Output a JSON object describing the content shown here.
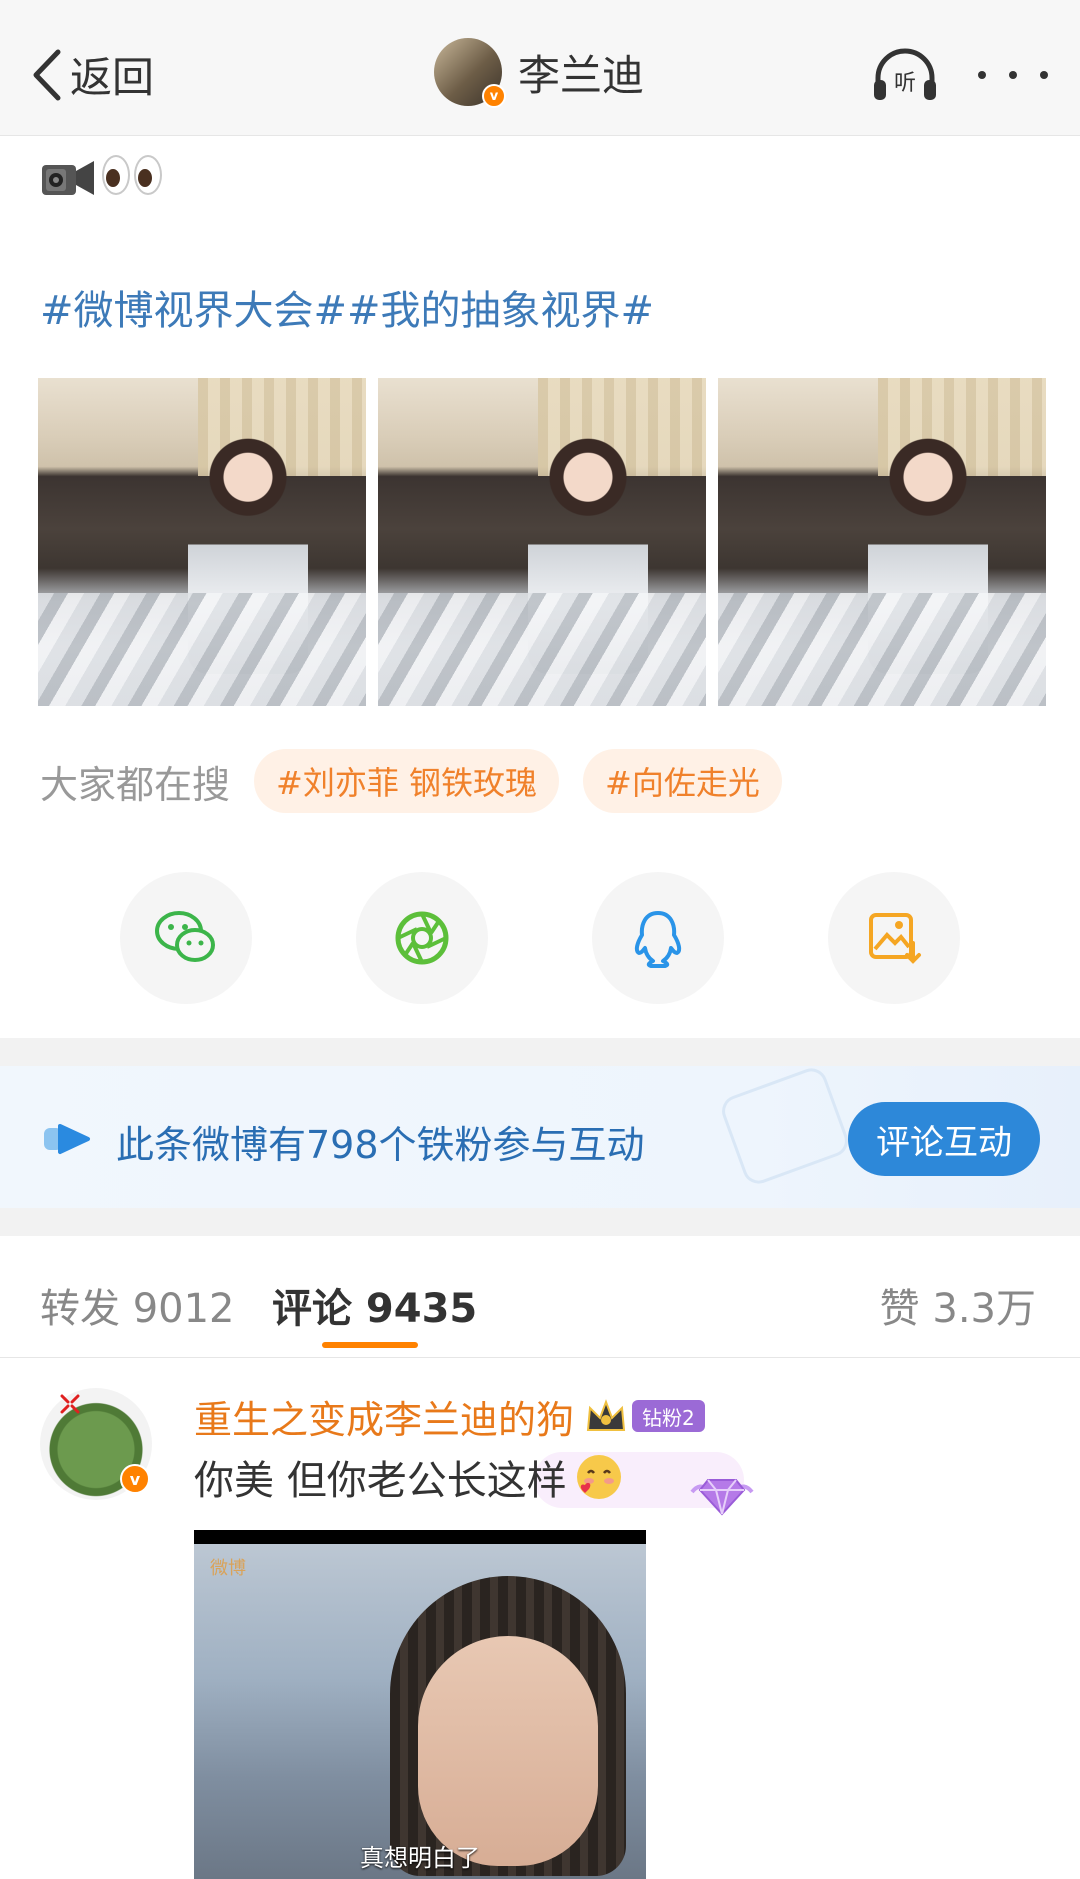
{
  "nav": {
    "back_label": "返回",
    "title": "李兰迪",
    "verified_mark": "v",
    "listen_label": "听"
  },
  "post": {
    "emojis": [
      "video-camera-icon",
      "eyes-icon"
    ],
    "hashtags": "#微博视界大会##我的抽象视界#",
    "photo_count": 3
  },
  "hot_search": {
    "label": "大家都在搜",
    "tags": [
      "#刘亦菲 钢铁玫瑰",
      "#向佐走光"
    ]
  },
  "share": {
    "items": [
      "wechat-icon",
      "moments-icon",
      "qq-icon",
      "save-image-icon"
    ]
  },
  "fans_banner": {
    "text": "此条微博有798个铁粉参与互动",
    "button": "评论互动"
  },
  "tabs": {
    "repost": "转发 9012",
    "comment": "评论 9435",
    "like": "赞 3.3万"
  },
  "comment": {
    "username": "重生之变成李兰迪的狗",
    "fan_badge": "钻粉2",
    "text": "你美 但你老公长这样",
    "verified_mark": "v",
    "image_watermark": "微博",
    "image_subtitle": "真想明白了"
  },
  "colors": {
    "link_blue": "#3d7ab8",
    "accent_orange": "#ff8200",
    "tag_orange": "#f0812b",
    "button_blue": "#2d88d9"
  }
}
